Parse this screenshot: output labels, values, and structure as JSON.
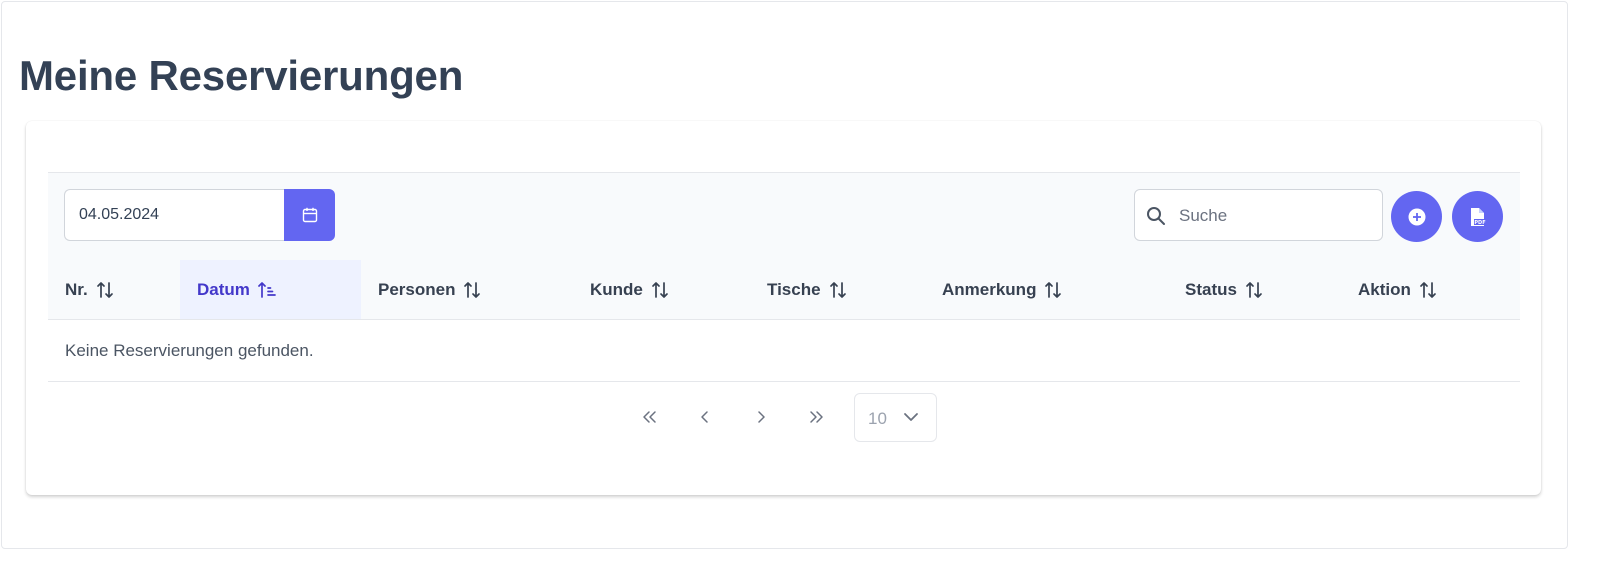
{
  "page": {
    "title": "Meine Reservierungen"
  },
  "toolbar": {
    "date_value": "04.05.2024",
    "calendar_icon": "calendar-icon",
    "search_placeholder": "Suche",
    "search_icon": "search-icon",
    "add_icon": "plus-circle-icon",
    "pdf_icon": "pdf-file-icon"
  },
  "table": {
    "columns": [
      {
        "label": "Nr.",
        "sort": "none"
      },
      {
        "label": "Datum",
        "sort": "ascending"
      },
      {
        "label": "Personen",
        "sort": "none"
      },
      {
        "label": "Kunde",
        "sort": "none"
      },
      {
        "label": "Tische",
        "sort": "none"
      },
      {
        "label": "Anmerkung",
        "sort": "none"
      },
      {
        "label": "Status",
        "sort": "none"
      },
      {
        "label": "Aktion",
        "sort": "none"
      }
    ],
    "empty_message": "Keine Reservierungen gefunden."
  },
  "pagination": {
    "first_icon": "chevrons-left-icon",
    "prev_icon": "chevron-left-icon",
    "next_icon": "chevron-right-icon",
    "last_icon": "chevrons-right-icon",
    "rows_per_page": "10"
  },
  "colors": {
    "accent": "#6366f1",
    "active_sort_bg": "#eef2ff",
    "active_sort_text": "#4338ca",
    "heading": "#334155"
  }
}
